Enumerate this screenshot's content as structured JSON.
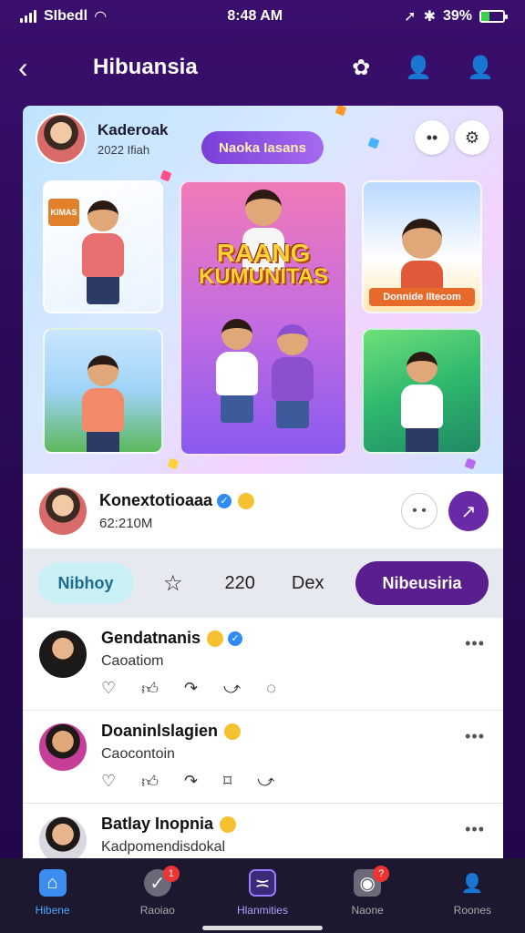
{
  "status": {
    "carrier": "SIbedl",
    "time": "8:48 AM",
    "battery": "39%",
    "battery_level": 0.39
  },
  "header": {
    "title": "Hibuansia",
    "back": "‹"
  },
  "hero": {
    "user_name": "Kaderoak",
    "user_sub": "2022 Ifiah",
    "pill": "Naoka Iasans",
    "title_line1": "RAANG",
    "title_line2": "KUMUNITAS",
    "tile_top_left_tag": "KIMAS",
    "tile_right_label": "Donnide Iltecom"
  },
  "post": {
    "name": "Konextotioaaa",
    "time": "62:210M"
  },
  "actions": {
    "left_pill": "Nibhoy",
    "count": "220",
    "dex": "Dex",
    "right_pill": "Nibeusiria"
  },
  "comments": [
    {
      "name": "Gendatnanis",
      "sub": "Caoatiom"
    },
    {
      "name": "Doaninlslagien",
      "sub": "Caocontoin"
    },
    {
      "name": "Batlay Inopnia",
      "sub": "Kadpomendisdokal"
    }
  ],
  "nav": [
    {
      "label": "Hibene",
      "icon": "home-icon",
      "badge": ""
    },
    {
      "label": "Raoiao",
      "icon": "rooster-icon",
      "badge": "1"
    },
    {
      "label": "Hlanmities",
      "icon": "community-icon",
      "badge": ""
    },
    {
      "label": "Naone",
      "icon": "notification-icon",
      "badge": "?"
    },
    {
      "label": "Roones",
      "icon": "profile-icon",
      "badge": ""
    }
  ],
  "colors": {
    "accent": "#5a1e8e",
    "brand_blue": "#4aa8ff",
    "background": "#2a0a55"
  }
}
